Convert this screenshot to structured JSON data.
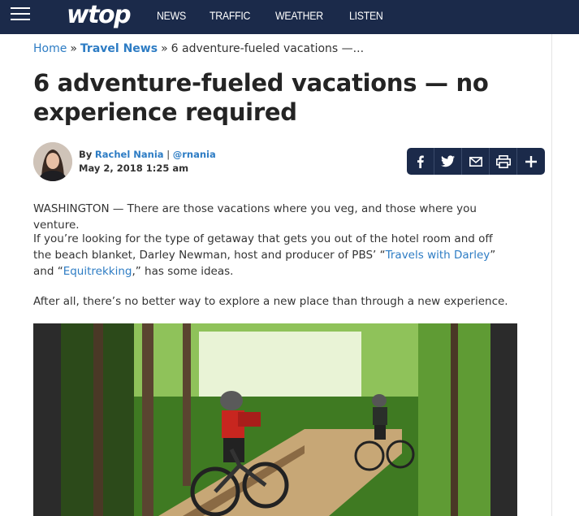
{
  "header": {
    "logo": "wtop",
    "nav": [
      "NEWS",
      "TRAFFIC",
      "WEATHER",
      "LISTEN"
    ],
    "colors": {
      "bar": "#1b2a4a",
      "link": "#2d7cc4"
    }
  },
  "breadcrumb": {
    "home": "Home",
    "sep": "»",
    "section": "Travel News",
    "current": "6 adventure-fueled vacations —..."
  },
  "article": {
    "title": "6 adventure-fueled vacations — no experience required",
    "author_prefix": "By",
    "author": "Rachel Nania",
    "divider": "|",
    "handle": "@rnania",
    "date": "May 2, 2018 1:25 am",
    "p1": "WASHINGTON — There are those vacations where you veg, and those where you venture.",
    "p2_a": "If you’re looking for the type of getaway that gets you out of the hotel room and off the beach blanket, Darley Newman, host and producer of PBS’ “",
    "p2_link1": "Travels with Darley",
    "p2_b": "” and “",
    "p2_link2": "Equitrekking",
    "p2_c": ",” has some ideas.",
    "p3": "After all, there’s no better way to explore a new place than through a new experience."
  },
  "share_icons": [
    "facebook-icon",
    "twitter-icon",
    "email-icon",
    "print-icon",
    "plus-icon"
  ]
}
